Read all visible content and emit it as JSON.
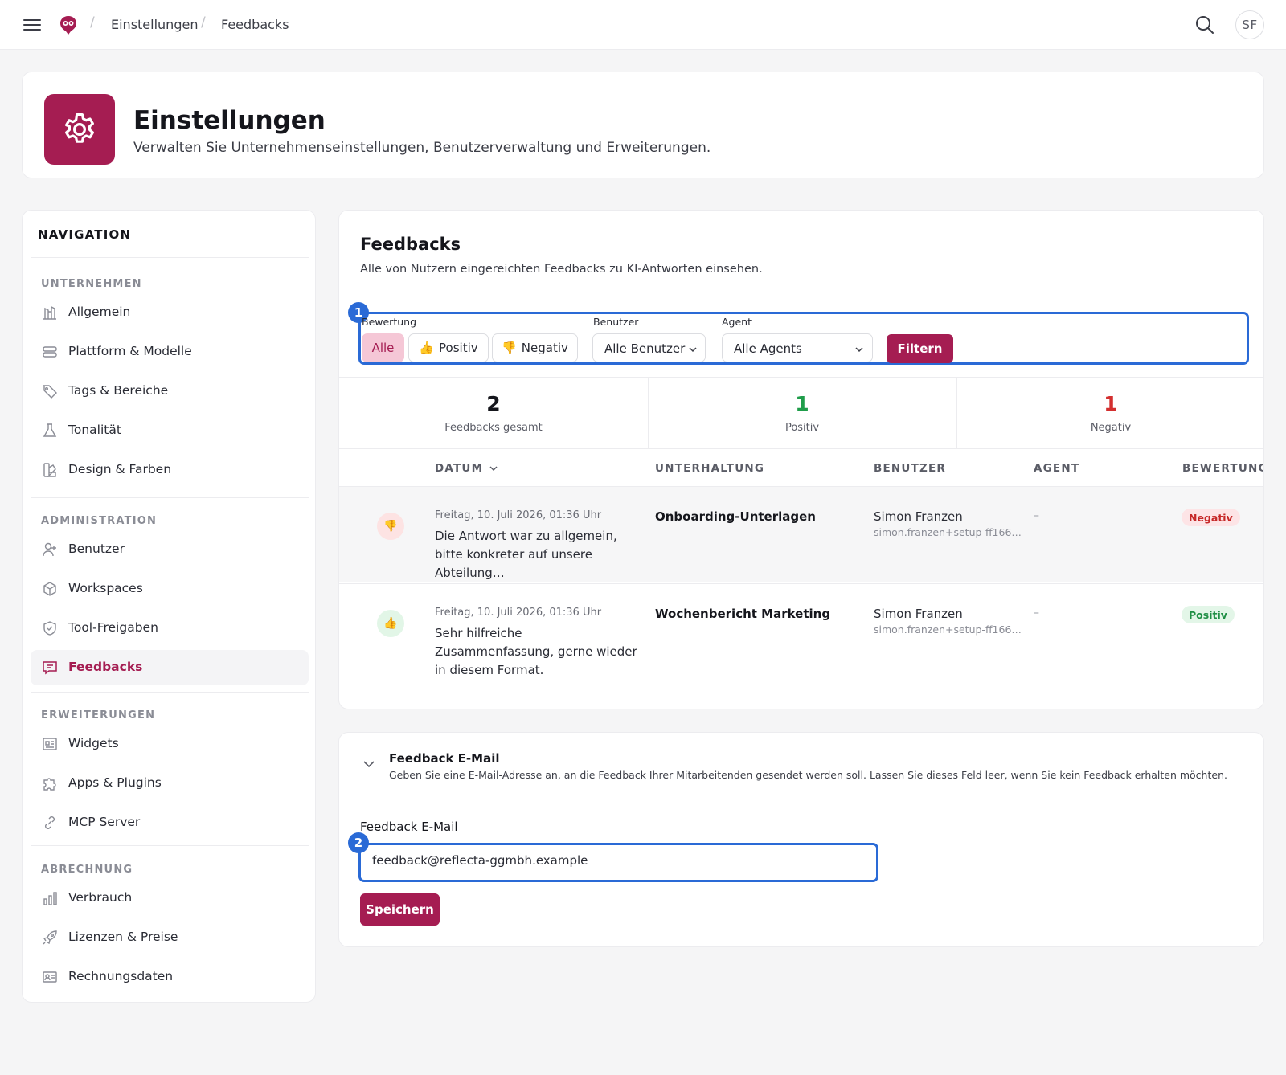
{
  "breadcrumb": [
    "Einstellungen",
    "Feedbacks"
  ],
  "user_initials": "SF",
  "header": {
    "title": "Einstellungen",
    "subtitle": "Verwalten Sie Unternehmenseinstellungen, Benutzerverwaltung und Erweiterungen."
  },
  "sidebar": {
    "title": "NAVIGATION",
    "sections": [
      {
        "label": "UNTERNEHMEN",
        "items": [
          {
            "label": "Allgemein",
            "icon": "chart-building-icon"
          },
          {
            "label": "Plattform & Modelle",
            "icon": "server-icon"
          },
          {
            "label": "Tags & Bereiche",
            "icon": "tag-icon"
          },
          {
            "label": "Tonalität",
            "icon": "flask-icon"
          },
          {
            "label": "Design & Farben",
            "icon": "palette-icon"
          }
        ]
      },
      {
        "label": "ADMINISTRATION",
        "items": [
          {
            "label": "Benutzer",
            "icon": "user-plus-icon"
          },
          {
            "label": "Workspaces",
            "icon": "cube-icon"
          },
          {
            "label": "Tool-Freigaben",
            "icon": "shield-check-icon"
          },
          {
            "label": "Feedbacks",
            "icon": "message-icon",
            "active": true
          }
        ]
      },
      {
        "label": "ERWEITERUNGEN",
        "items": [
          {
            "label": "Widgets",
            "icon": "newspaper-icon"
          },
          {
            "label": "Apps & Plugins",
            "icon": "puzzle-icon"
          },
          {
            "label": "MCP Server",
            "icon": "link-icon"
          }
        ]
      },
      {
        "label": "ABRECHNUNG",
        "items": [
          {
            "label": "Verbrauch",
            "icon": "bar-chart-icon"
          },
          {
            "label": "Lizenzen & Preise",
            "icon": "rocket-icon"
          },
          {
            "label": "Rechnungsdaten",
            "icon": "id-card-icon"
          }
        ]
      }
    ]
  },
  "feedbacks": {
    "title": "Feedbacks",
    "description": "Alle von Nutzern eingereichten Feedbacks zu KI-Antworten einsehen.",
    "filter": {
      "rating_label": "Bewertung",
      "user_label": "Benutzer",
      "agent_label": "Agent",
      "chips": [
        "Alle",
        "Positiv",
        "Negativ"
      ],
      "user_value": "Alle Benutzer",
      "agent_value": "Alle Agents",
      "submit": "Filtern"
    },
    "stats": [
      {
        "value": "2",
        "label": "Feedbacks gesamt",
        "color": "#15161c"
      },
      {
        "value": "1",
        "label": "Positiv",
        "color": "#1f9d4a"
      },
      {
        "value": "1",
        "label": "Negativ",
        "color": "#d32f2f"
      }
    ],
    "columns": [
      "DATUM",
      "UNTERHALTUNG",
      "BENUTZER",
      "AGENT",
      "BEWERTUNG"
    ],
    "rows": [
      {
        "date": "Freitag, 10. Juli 2026, 01:36 Uhr",
        "text": "Die Antwort war zu allgemein, bitte konkreter auf unsere Abteilung…",
        "conversation": "Onboarding-Unterlagen",
        "user": "Simon Franzen",
        "email": "simon.franzen+setup-ff166…",
        "agent": "–",
        "rating": "Negativ"
      },
      {
        "date": "Freitag, 10. Juli 2026, 01:36 Uhr",
        "text": "Sehr hilfreiche Zusammenfassung, gerne wieder in diesem Format.",
        "conversation": "Wochenbericht Marketing",
        "user": "Simon Franzen",
        "email": "simon.franzen+setup-ff166…",
        "agent": "–",
        "rating": "Positiv"
      }
    ]
  },
  "email_section": {
    "title": "Feedback E-Mail",
    "description": "Geben Sie eine E-Mail-Adresse an, an die Feedback Ihrer Mitarbeitenden gesendet werden soll. Lassen Sie dieses Feld leer, wenn Sie kein Feedback erhalten möchten.",
    "field_label": "Feedback E-Mail",
    "value": "feedback@reflecta-ggmbh.example",
    "save": "Speichern"
  },
  "markers": [
    "1",
    "2"
  ],
  "colors": {
    "brand": "#a51d52",
    "highlight": "#2a6ad6"
  }
}
